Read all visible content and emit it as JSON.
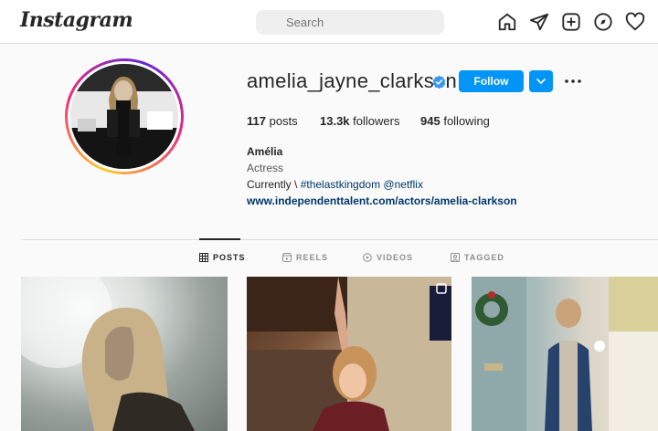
{
  "header": {
    "logo": "Instagram",
    "search_placeholder": "Search",
    "nav_icons": [
      "home-icon",
      "direct-icon",
      "new-post-icon",
      "explore-icon",
      "activity-icon"
    ]
  },
  "profile": {
    "username": "amelia_jayne_clarkson",
    "verified": true,
    "follow_label": "Follow",
    "stats": {
      "posts_count": "117",
      "posts_label": "posts",
      "followers_count": "13.3k",
      "followers_label": "followers",
      "following_count": "945",
      "following_label": "following"
    },
    "bio": {
      "name": "Amélia",
      "category": "Actress",
      "line_prefix": "Currently ",
      "line_sep": "\\ ",
      "hashtag": "#thelastkingdom",
      "mention": " @netflix",
      "link": "www.independenttalent.com/actors/amelia-clarkson"
    }
  },
  "tabs": [
    {
      "label": "POSTS",
      "active": true
    },
    {
      "label": "REELS",
      "active": false
    },
    {
      "label": "VIDEOS",
      "active": false
    },
    {
      "label": "TAGGED",
      "active": false
    }
  ],
  "colors": {
    "accent": "#0095f6",
    "link": "#00376b",
    "verified": "#3897f0"
  }
}
